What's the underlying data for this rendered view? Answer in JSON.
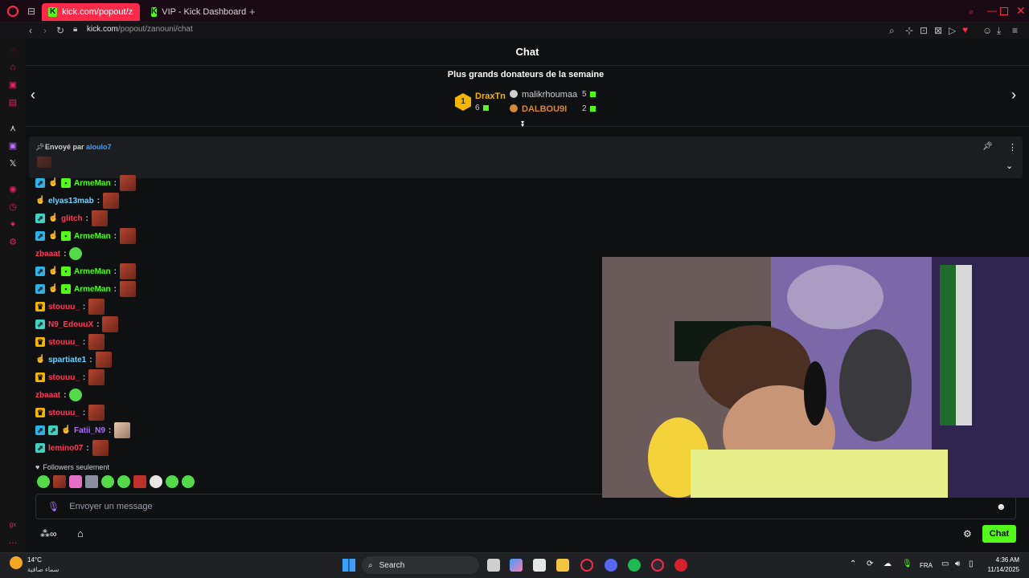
{
  "browser": {
    "tabs": [
      {
        "label": "kick.com/popout/zanouni",
        "active": true
      },
      {
        "label": "VIP - Kick Dashboard",
        "active": false
      }
    ],
    "new_tab_label": "+",
    "url_domain": "kick.com",
    "url_path": "/popout/zanouni/chat"
  },
  "chat": {
    "title": "Chat",
    "leaderboard": {
      "title": "Plus grands donateurs de la semaine",
      "rank1": {
        "rank": "1",
        "name": "DraxTn",
        "amount": "6"
      },
      "rank2": {
        "name": "malikrhoumaa",
        "amount": "5"
      },
      "rank3": {
        "name": "DALBOU9I",
        "amount": "2"
      }
    },
    "pinned": {
      "label": "Envoyé par",
      "user": "aloulo7"
    },
    "messages": [
      {
        "user": "ArmeMan",
        "color": "#53fc18"
      },
      {
        "user": "elyas13mab",
        "color": "#6fd4ff"
      },
      {
        "user": "glitch",
        "color": "#ff3a5b"
      },
      {
        "user": "ArmeMan",
        "color": "#53fc18"
      },
      {
        "user": "zbaaat",
        "color": "#ff3a5b"
      },
      {
        "user": "ArmeMan",
        "color": "#53fc18"
      },
      {
        "user": "ArmeMan",
        "color": "#53fc18"
      },
      {
        "user": "stouuu_",
        "color": "#ff3a5b"
      },
      {
        "user": "N9_EdouuX",
        "color": "#ff3a5b"
      },
      {
        "user": "stouuu_",
        "color": "#ff3a5b"
      },
      {
        "user": "spartiate1",
        "color": "#6fd4ff"
      },
      {
        "user": "stouuu_",
        "color": "#ff3a5b"
      },
      {
        "user": "zbaaat",
        "color": "#ff3a5b"
      },
      {
        "user": "stouuu_",
        "color": "#ff3a5b"
      },
      {
        "user": "Fatii_N9",
        "color": "#b66bff"
      },
      {
        "user": "lemino07",
        "color": "#ff3a5b"
      }
    ],
    "followers_only": "Followers seulement",
    "input_placeholder": "Envoyer un message",
    "send_label": "Chat"
  },
  "taskbar": {
    "weather_temp": "14°C",
    "weather_desc": "سماء صافية",
    "search_label": "Search",
    "language": "FRA",
    "time": "4:36 AM",
    "date": "11/14/2025"
  },
  "colors": {
    "kick_green": "#53fc18",
    "opera_red": "#ff2a4a"
  }
}
